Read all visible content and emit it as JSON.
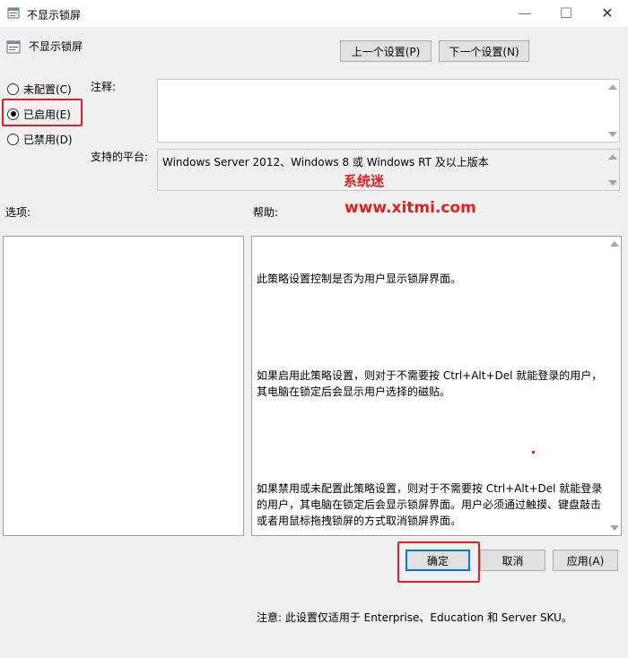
{
  "window": {
    "title": "不显示锁屏",
    "minimize_glyph": "—",
    "maximize_glyph": "☐",
    "close_glyph": "✕"
  },
  "header": {
    "title": "不显示锁屏"
  },
  "nav": {
    "prev_label": "上一个设置(P)",
    "next_label": "下一个设置(N)"
  },
  "state": {
    "options": [
      {
        "label": "未配置(C)",
        "checked": false
      },
      {
        "label": "已启用(E)",
        "checked": true
      },
      {
        "label": "已禁用(D)",
        "checked": false
      }
    ]
  },
  "comment": {
    "label": "注释:",
    "value": ""
  },
  "platform": {
    "label": "支持的平台:",
    "value": "Windows Server 2012、Windows 8 或 Windows RT 及以上版本"
  },
  "sections": {
    "options_label": "选项:",
    "help_label": "帮助:"
  },
  "help": {
    "paragraphs": [
      "此策略设置控制是否为用户显示锁屏界面。",
      "如果启用此策略设置，则对于不需要按 Ctrl+Alt+Del 就能登录的用户，其电脑在锁定后会显示用户选择的磁贴。",
      "如果禁用或未配置此策略设置，则对于不需要按 Ctrl+Alt+Del 就能登录的用户，其电脑在锁定后会显示锁屏界面。用户必须通过触摸、键盘敲击或者用鼠标拖拽锁屏的方式取消锁屏界面。",
      "注意: 此设置仅适用于 Enterprise、Education 和 Server SKU。"
    ]
  },
  "watermark": {
    "brand": "系统迷",
    "url": "www.xitmi.com"
  },
  "footer": {
    "ok_label": "确定",
    "cancel_label": "取消",
    "apply_label": "应用(A)"
  },
  "colors": {
    "highlight_red": "#e02020",
    "accent_blue": "#0078d7"
  }
}
